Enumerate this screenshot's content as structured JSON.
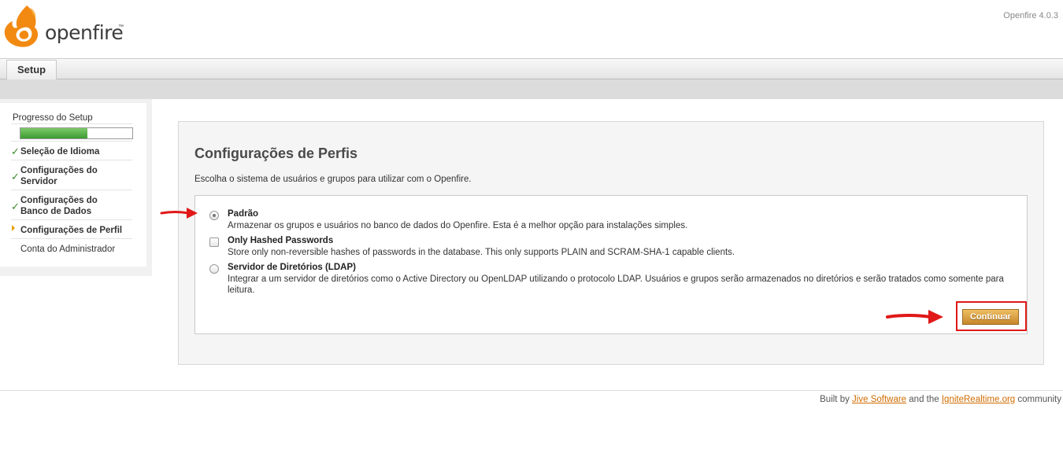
{
  "header": {
    "logo_text": "openfire",
    "logo_tm": "™",
    "version": "Openfire 4.0.3"
  },
  "tabs": [
    {
      "label": "Setup",
      "active": true
    }
  ],
  "sidebar": {
    "progress_title": "Progresso do Setup",
    "progress_fraction": 0.6,
    "steps": [
      {
        "label": "Seleção de Idioma",
        "status": "done"
      },
      {
        "label": "Configurações do Servidor",
        "status": "done"
      },
      {
        "label": "Configurações do Banco de Dados",
        "status": "done"
      },
      {
        "label": "Configurações de Perfil",
        "status": "current"
      },
      {
        "label": "Conta do Administrador",
        "status": "todo"
      }
    ]
  },
  "main": {
    "title": "Configurações de Perfis",
    "intro": "Escolha o sistema de usuários e grupos para utilizar com o Openfire.",
    "options": [
      {
        "title": "Padrão",
        "description": "Armazenar os grupos e usuários no banco de dados do Openfire. Esta é a melhor opção para instalações simples.",
        "control": "radio",
        "checked": true
      },
      {
        "title": "Only Hashed Passwords",
        "description": "Store only non-reversible hashes of passwords in the database. This only supports PLAIN and SCRAM-SHA-1 capable clients.",
        "control": "checkbox",
        "checked": false
      },
      {
        "title": "Servidor de Diretórios (LDAP)",
        "description": "Integrar a um servidor de diretórios como o Active Directory ou OpenLDAP utilizando o protocolo LDAP. Usuários e grupos serão armazenados no diretórios e serão tratados como somente para leitura.",
        "control": "radio",
        "checked": false
      }
    ],
    "continue_label": "Continuar"
  },
  "footer": {
    "prefix": "Built by",
    "link1": "Jive Software",
    "middle": "and the",
    "link2": "IgniteRealtime.org",
    "suffix": "community"
  },
  "colors": {
    "accent": "#d06c00",
    "progress": "#4caf3f",
    "annotation": "#e01818"
  }
}
